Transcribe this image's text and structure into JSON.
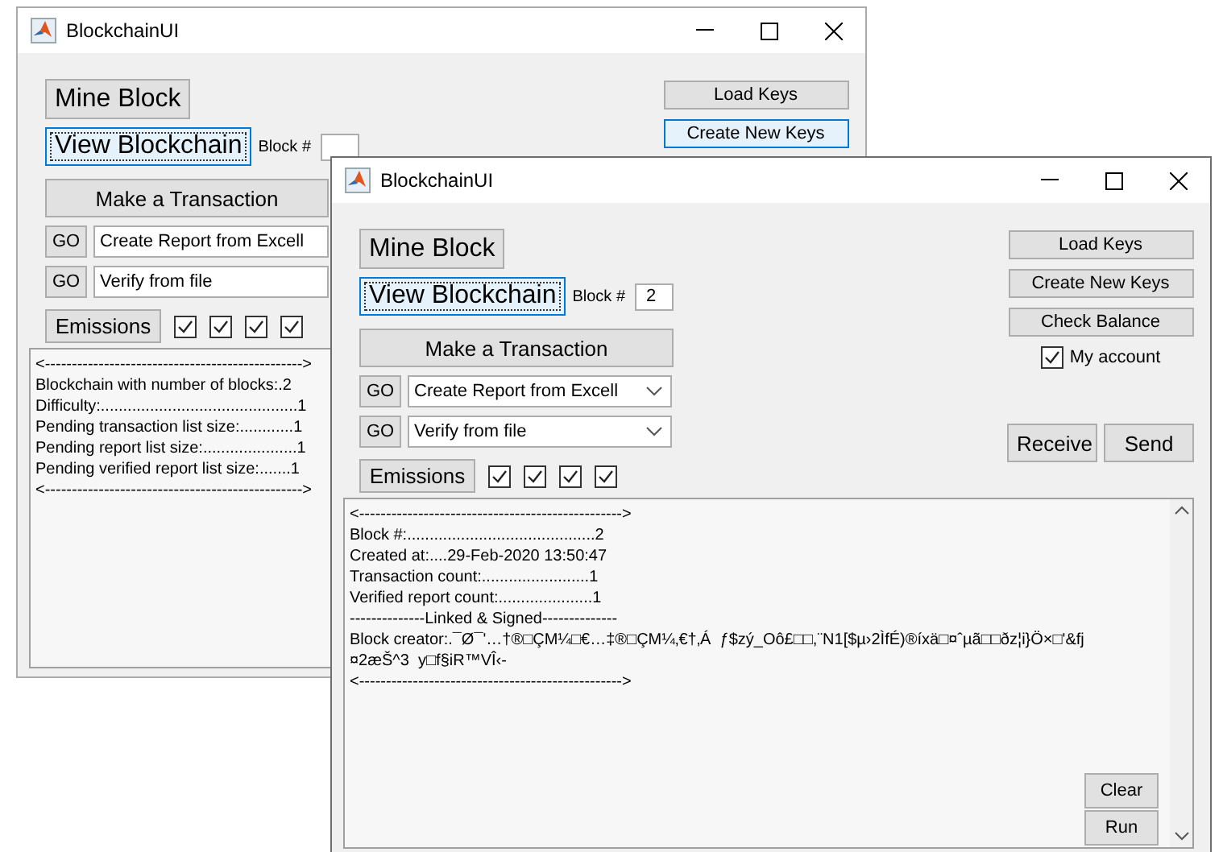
{
  "windows": [
    {
      "title": "BlockchainUI",
      "active": false,
      "mine_button": "Mine Block",
      "view_button": "View Blockchain",
      "view_focused": true,
      "block_label": "Block #",
      "transaction_button": "Make a Transaction",
      "actions": [
        {
          "go": "GO",
          "value": "Create Report from Excell"
        },
        {
          "go": "GO",
          "value": "Verify from file"
        }
      ],
      "emissions_button": "Emissions",
      "emission_checks": [
        {
          "checked": true
        },
        {
          "checked": true
        },
        {
          "checked": true
        },
        {
          "checked": true
        }
      ],
      "side_buttons": [
        {
          "label": "Load Keys",
          "focused": false
        },
        {
          "label": "Create New Keys",
          "focused": true
        }
      ],
      "output_lines": [
        "<------------------------------------------------>",
        "Blockchain with number of blocks:.2",
        "Difficulty:............................................1",
        "Pending transaction list size:............1",
        "Pending report list size:.....................1",
        "Pending verified report list size:.......1",
        "<------------------------------------------------>"
      ]
    },
    {
      "title": "BlockchainUI",
      "active": true,
      "mine_button": "Mine Block",
      "view_button": "View Blockchain",
      "view_focused": true,
      "block_label": "Block #",
      "block_value": "2",
      "transaction_button": "Make a Transaction",
      "actions": [
        {
          "go": "GO",
          "value": "Create Report from Excell"
        },
        {
          "go": "GO",
          "value": "Verify from file"
        }
      ],
      "emissions_button": "Emissions",
      "emission_checks": [
        {
          "checked": true
        },
        {
          "checked": true
        },
        {
          "checked": true
        },
        {
          "checked": true
        }
      ],
      "side_buttons": [
        {
          "label": "Load Keys",
          "focused": false
        },
        {
          "label": "Create New Keys",
          "focused": false
        },
        {
          "label": "Check Balance",
          "focused": false
        }
      ],
      "my_account": {
        "label": "My account",
        "checked": true
      },
      "transfer_buttons": [
        "Receive",
        "Send"
      ],
      "output_lines": [
        "<------------------------------------------------->",
        "Block #:..........................................2",
        "Created at:....29-Feb-2020 13:50:47",
        "Transaction count:........................1",
        "Verified report count:.....................1",
        "--------------Linked & Signed--------------",
        "Block creator:.¯Ø¯'…†®□ÇM¼□€…‡®□ÇM¼‚€†‚Á  ƒ$zý_Oô£□□,¨N1[$µ›2ÌfÉ)®íxä□¤ˆµã□□ðz¦i}Ö×□'&fj",
        "¤2æŠ^3  y□f§iR™VÎ‹-",
        "<------------------------------------------------->"
      ],
      "console_buttons": [
        "Clear",
        "Run"
      ]
    }
  ]
}
